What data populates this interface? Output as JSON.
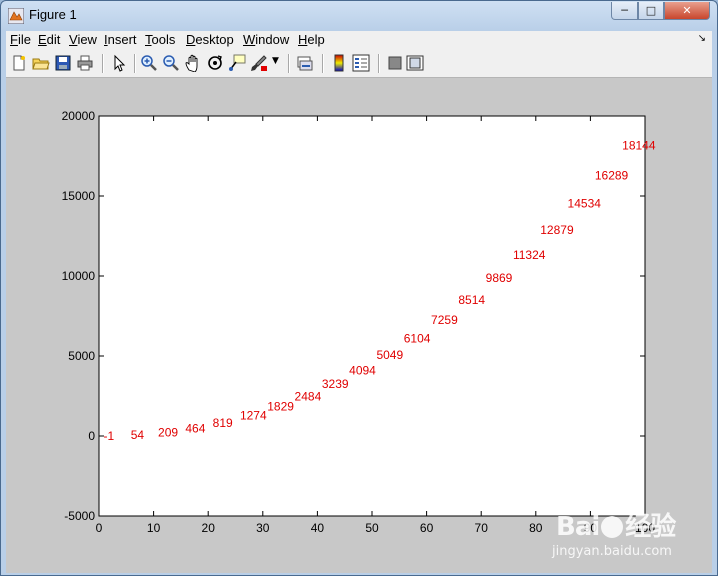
{
  "window": {
    "title": "Figure 1",
    "icon": "matlab-figure-icon",
    "controls": [
      "minimize",
      "maximize",
      "close"
    ]
  },
  "menu": {
    "items": [
      "File",
      "Edit",
      "View",
      "Insert",
      "Tools",
      "Desktop",
      "Window",
      "Help"
    ]
  },
  "toolbar": {
    "icons": [
      "new-figure-icon",
      "open-file-icon",
      "save-icon",
      "print-icon",
      "edit-plot-arrow-icon",
      "zoom-in-icon",
      "zoom-out-icon",
      "pan-hand-icon",
      "rotate-3d-icon",
      "data-cursor-icon",
      "brush-icon",
      "link-plot-icon",
      "colorbar-icon",
      "legend-icon",
      "hide-plot-tools-icon",
      "show-plot-tools-icon"
    ]
  },
  "chart_data": {
    "type": "scatter",
    "marker": "text-labels",
    "label_color": "#e00000",
    "x": [
      1,
      6,
      11,
      16,
      21,
      26,
      31,
      36,
      41,
      46,
      51,
      56,
      61,
      66,
      71,
      76,
      81,
      86,
      91,
      96
    ],
    "values": [
      -1,
      54,
      209,
      464,
      819,
      1274,
      1829,
      2484,
      3239,
      4094,
      5049,
      6104,
      7259,
      8514,
      9869,
      11324,
      12879,
      14534,
      16289,
      18144
    ],
    "labels": [
      "-1",
      "54",
      "209",
      "464",
      "819",
      "1274",
      "1829",
      "2484",
      "3239",
      "4094",
      "5049",
      "6104",
      "7259",
      "8514",
      "9869",
      "11324",
      "12879",
      "14534",
      "16289",
      "18144"
    ],
    "xlim": [
      0,
      100
    ],
    "ylim": [
      -5000,
      20000
    ],
    "xticks": [
      0,
      10,
      20,
      30,
      40,
      50,
      60,
      70,
      80,
      90,
      100
    ],
    "yticks": [
      -5000,
      0,
      5000,
      10000,
      15000,
      20000
    ],
    "xtick_labels": [
      "0",
      "10",
      "20",
      "30",
      "40",
      "50",
      "60",
      "70",
      "80",
      "90",
      "100"
    ],
    "ytick_labels": [
      "-5000",
      "0",
      "5000",
      "10000",
      "15000",
      "20000"
    ],
    "grid": false,
    "title": "",
    "xlabel": "",
    "ylabel": ""
  },
  "watermark": {
    "brand": "Bai",
    "brand_suffix": "经验",
    "url": "jingyan.baidu.com"
  }
}
